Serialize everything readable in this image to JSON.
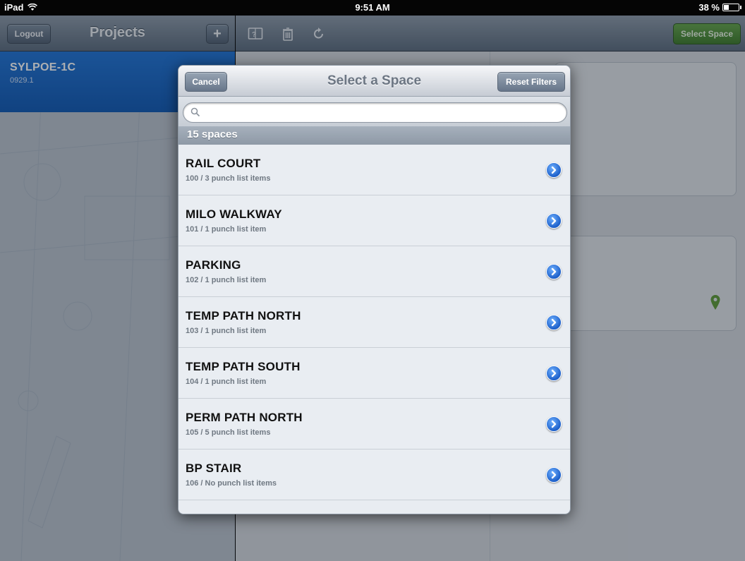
{
  "status_bar": {
    "device": "iPad",
    "time": "9:51 AM",
    "battery": "38 %",
    "battery_level": 0.38
  },
  "master": {
    "logout_label": "Logout",
    "title": "Projects",
    "add_label": "+",
    "project": {
      "name": "SYLPOE-1C",
      "number": "0929.1"
    }
  },
  "detail": {
    "select_space_label": "Select Space",
    "icons": [
      "map-book-icon",
      "trash-icon",
      "refresh-icon"
    ]
  },
  "modal": {
    "cancel_label": "Cancel",
    "title": "Select a Space",
    "reset_label": "Reset Filters",
    "search": {
      "value": "",
      "placeholder": ""
    },
    "count_label": "15 spaces",
    "spaces": [
      {
        "name": "RAIL COURT",
        "detail": "100 / 3 punch list items"
      },
      {
        "name": "MILO WALKWAY",
        "detail": "101 / 1 punch list item"
      },
      {
        "name": "PARKING",
        "detail": "102 / 1 punch list item"
      },
      {
        "name": "TEMP PATH NORTH",
        "detail": "103 / 1 punch list item"
      },
      {
        "name": "TEMP PATH SOUTH",
        "detail": "104 / 1 punch list item"
      },
      {
        "name": "PERM PATH NORTH",
        "detail": "105 / 5 punch list items"
      },
      {
        "name": "BP STAIR",
        "detail": "106 / No punch list items"
      }
    ]
  },
  "colors": {
    "accent_blue": "#1665c7",
    "select_green": "#4a8a35",
    "nav_gray": "#6b7b8d"
  }
}
